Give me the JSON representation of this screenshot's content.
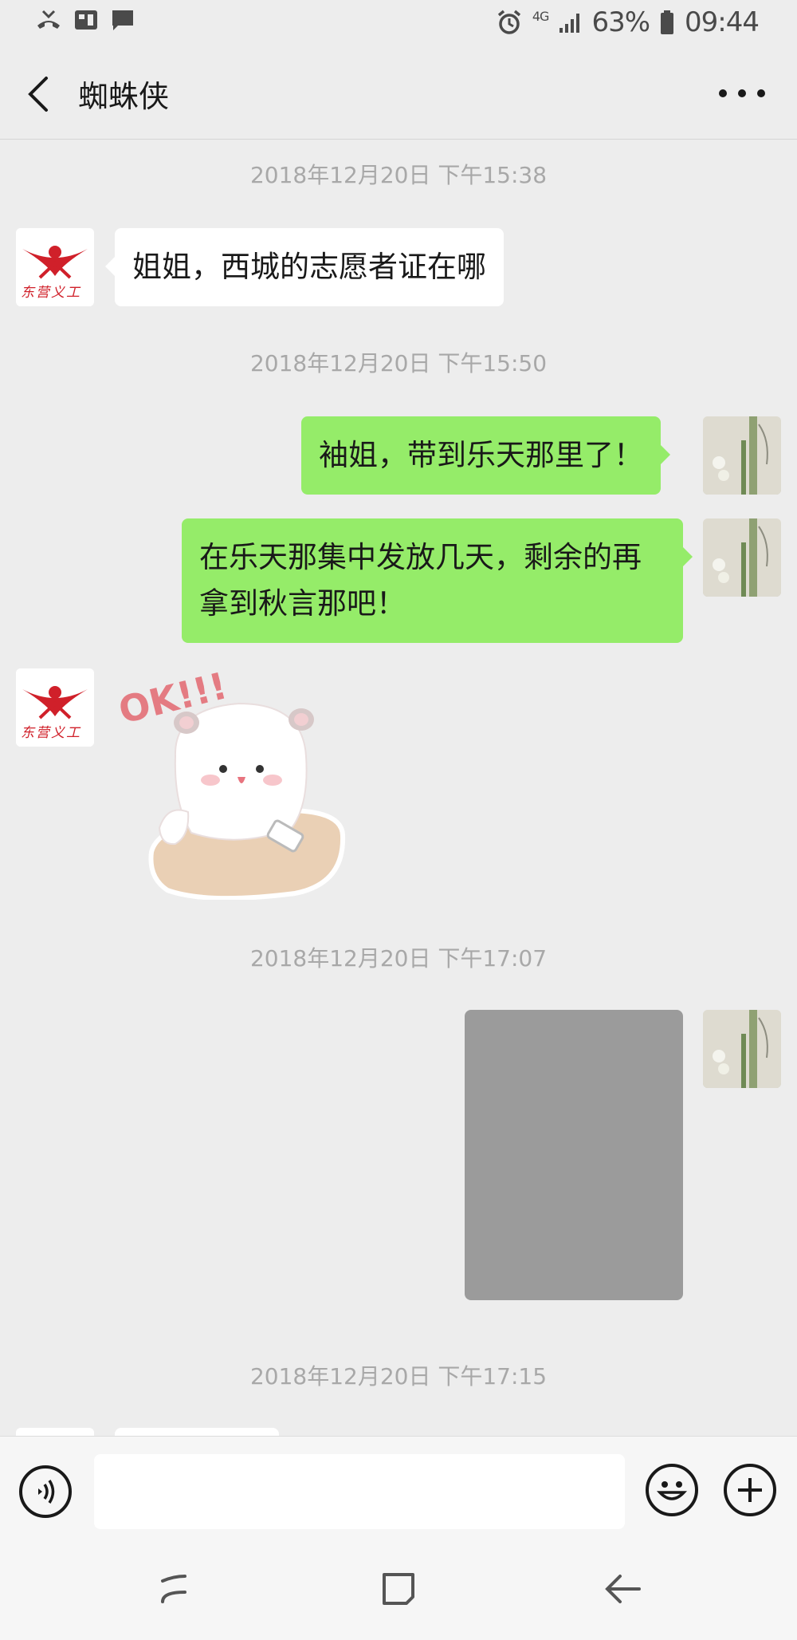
{
  "status_bar": {
    "network": "4G",
    "battery": "63%",
    "time": "09:44"
  },
  "header": {
    "title": "蜘蛛侠"
  },
  "messages": [
    {
      "type": "timestamp",
      "text": "2018年12月20日 下午15:38"
    },
    {
      "type": "text",
      "side": "left",
      "text": "姐姐，西城的志愿者证在哪"
    },
    {
      "type": "timestamp",
      "text": "2018年12月20日 下午15:50"
    },
    {
      "type": "text",
      "side": "right",
      "text": "袖姐，带到乐天那里了！"
    },
    {
      "type": "text",
      "side": "right",
      "lines": [
        "在乐天那集中发放几天，剩余的再",
        "拿到秋言那吧！"
      ]
    },
    {
      "type": "sticker",
      "side": "left",
      "text": "OK!!!"
    },
    {
      "type": "timestamp",
      "text": "2018年12月20日 下午17:07"
    },
    {
      "type": "image",
      "side": "right"
    },
    {
      "type": "timestamp",
      "text": "2018年12月20日 下午17:15"
    }
  ],
  "avatars": {
    "left_logo_text": "东营义工"
  },
  "colors": {
    "background": "#ededed",
    "sent_bubble": "#95ec69",
    "received_bubble": "#ffffff",
    "timestamp_text": "#a8a8a8"
  }
}
